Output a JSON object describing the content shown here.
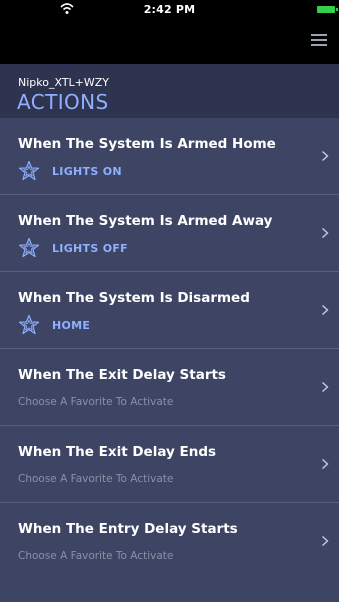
{
  "status_bar": {
    "time": "2:42 PM"
  },
  "icons": {
    "wifi": "wifi-icon",
    "battery": "battery-icon",
    "menu": "hamburger-menu-icon",
    "favorite": "star-icon",
    "chevron": "chevron-right-icon"
  },
  "header": {
    "system_name": "Nipko_XTL+WZY",
    "title": "ACTIONS"
  },
  "colors": {
    "background": "#3e4564",
    "header_background": "#2e3350",
    "accent": "#8fb0ff",
    "muted_text": "#8a90a6",
    "battery": "#35d04a"
  },
  "actions": [
    {
      "title": "When The System Is Armed Home",
      "favorite": "LIGHTS ON"
    },
    {
      "title": "When The System Is Armed Away",
      "favorite": "LIGHTS OFF"
    },
    {
      "title": "When The System Is Disarmed",
      "favorite": "HOME"
    },
    {
      "title": "When The Exit Delay Starts",
      "placeholder": "Choose A Favorite To Activate"
    },
    {
      "title": "When The Exit Delay Ends",
      "placeholder": "Choose A Favorite To Activate"
    },
    {
      "title": "When The Entry Delay Starts",
      "placeholder": "Choose A Favorite To Activate"
    }
  ]
}
